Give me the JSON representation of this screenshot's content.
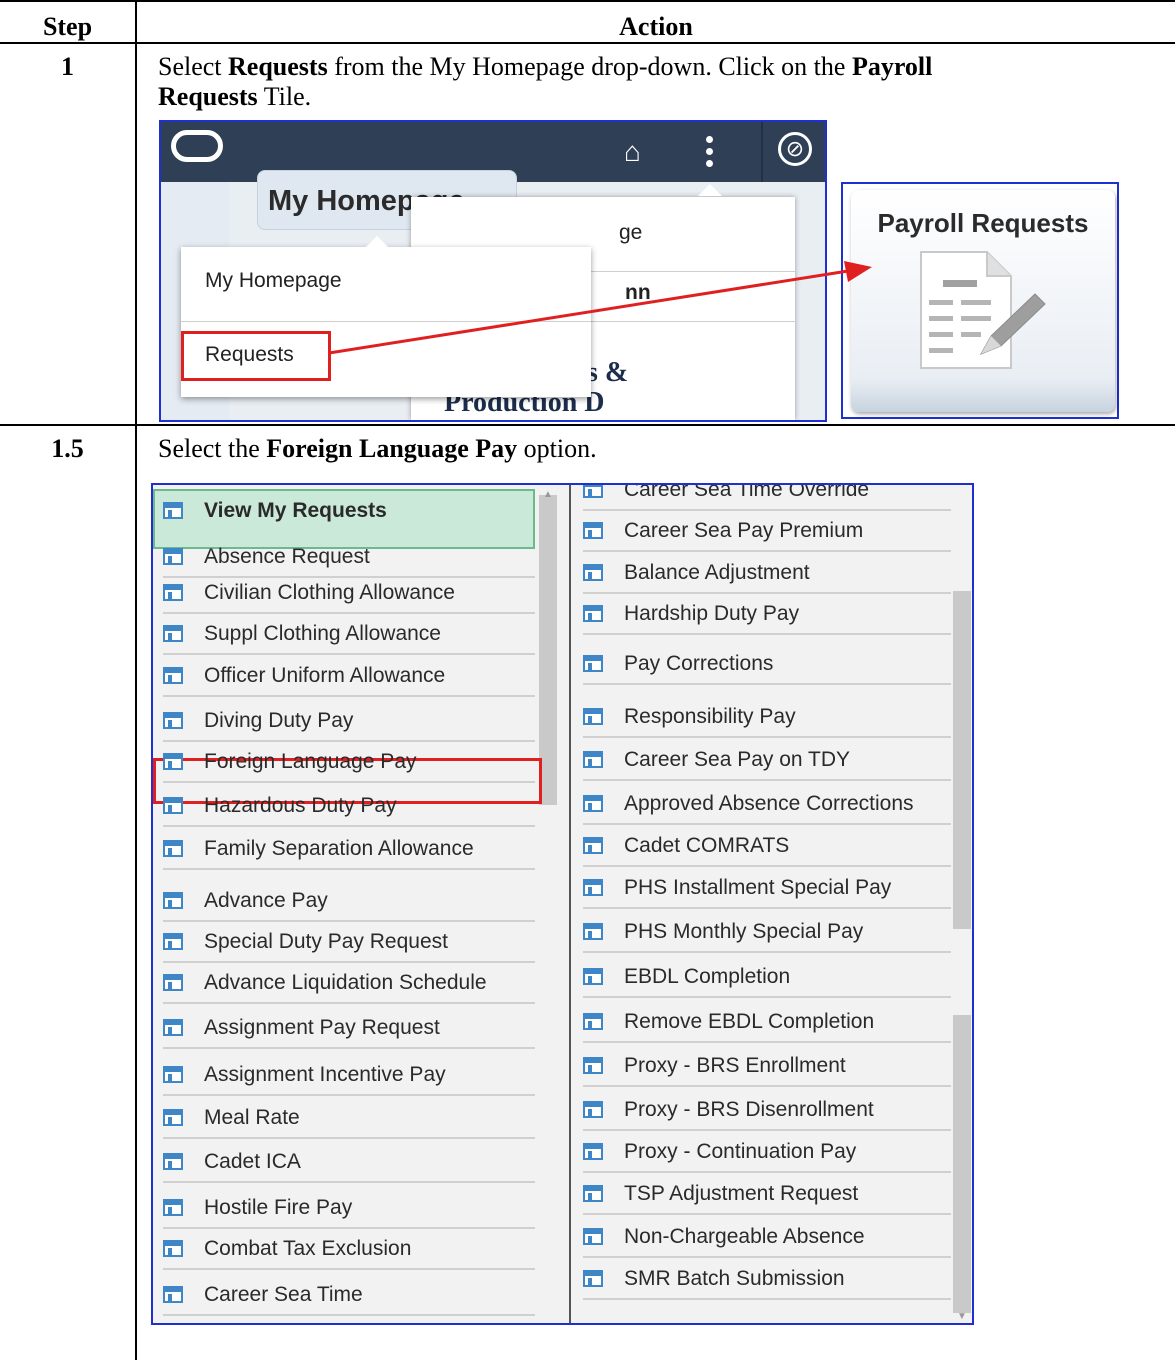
{
  "table": {
    "header_step": "Step",
    "header_action": "Action",
    "rows": [
      {
        "step": "1",
        "text_1": "Select ",
        "bold_1": "Requests",
        "text_2": " from the My Homepage drop-down. Click on the ",
        "bold_2a": "Payroll",
        "bold_2b": "Requests",
        "text_3": " Tile."
      },
      {
        "step": "1.5",
        "text_1": "Select the ",
        "bold_1": "Foreign Language Pay",
        "text_2": " option."
      }
    ]
  },
  "screenshot1": {
    "homepage_button": "My Homepage",
    "bg_text_1": "ge",
    "bg_text_2": "nn",
    "bg_text_3": "s &",
    "bg_text_4": "Production D",
    "dropdown_items": [
      "My Homepage",
      "Requests"
    ],
    "tile_title": "Payroll Requests",
    "home_icon": "home-icon",
    "menu_icon": "kebab-icon",
    "nav_icon": "compass-icon"
  },
  "screenshot2": {
    "left_items": [
      "View My Requests",
      "Absence Request",
      "Civilian Clothing Allowance",
      "Suppl Clothing Allowance",
      "Officer Uniform Allowance",
      "Diving Duty Pay",
      "Foreign Language Pay",
      "Hazardous Duty Pay",
      "Family Separation Allowance",
      "Advance Pay",
      "Special Duty Pay Request",
      "Advance Liquidation Schedule",
      "Assignment Pay Request",
      "Assignment Incentive Pay",
      "Meal Rate",
      "Cadet ICA",
      "Hostile Fire Pay",
      "Combat Tax Exclusion",
      "Career Sea Time"
    ],
    "right_items": [
      "Career Sea Time Override",
      "Career Sea Pay Premium",
      "Balance Adjustment",
      "Hardship Duty Pay",
      "Pay Corrections",
      "Responsibility Pay",
      "Career Sea Pay on TDY",
      "Approved Absence Corrections",
      "Cadet COMRATS",
      "PHS Installment Special Pay",
      "PHS Monthly Special Pay",
      "EBDL Completion",
      "Remove EBDL Completion",
      "Proxy - BRS Enrollment",
      "Proxy - BRS Disenrollment",
      "Proxy - Continuation Pay",
      "TSP Adjustment Request",
      "Non-Chargeable Absence",
      "SMR Batch Submission"
    ],
    "highlight_color": "#e02020",
    "item_icon": "page-icon"
  }
}
